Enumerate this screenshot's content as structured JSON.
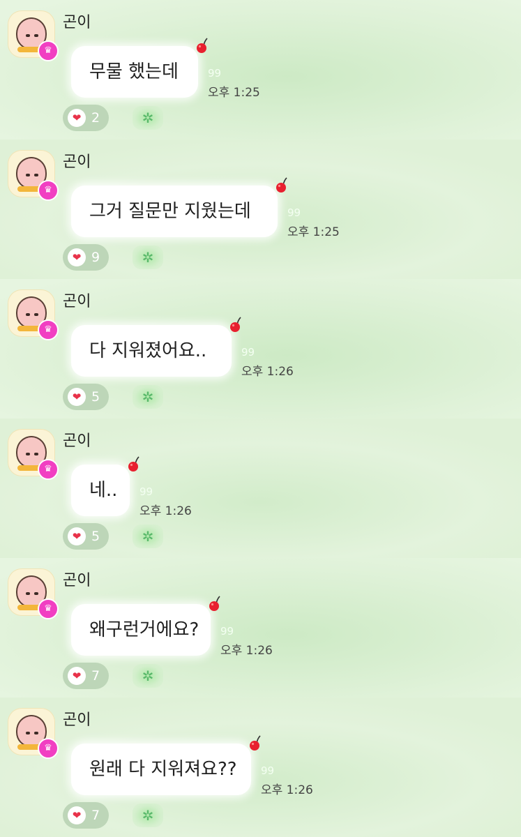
{
  "messages": [
    {
      "author": "곤이",
      "text": "무물 했는데",
      "read_count": "99",
      "time": "오후 1:25",
      "likes": "2"
    },
    {
      "author": "곤이",
      "text": "그거 질문만 지웠는데",
      "read_count": "99",
      "time": "오후 1:25",
      "likes": "9"
    },
    {
      "author": "곤이",
      "text": "다 지워졌어요..",
      "read_count": "99",
      "time": "오후 1:26",
      "likes": "5"
    },
    {
      "author": "곤이",
      "text": "네..",
      "read_count": "99",
      "time": "오후 1:26",
      "likes": "5"
    },
    {
      "author": "곤이",
      "text": "왜구런거에요?",
      "read_count": "99",
      "time": "오후 1:26",
      "likes": "7"
    },
    {
      "author": "곤이",
      "text": "원래 다 지워져요??",
      "read_count": "99",
      "time": "오후 1:26",
      "likes": "7"
    }
  ],
  "icons": {
    "avatar": "peach-character-avatar",
    "badge": "crown-icon",
    "bubble_marker": "cherry-icon",
    "like": "heart-icon",
    "reaction": "sparkle-icon"
  },
  "colors": {
    "background": "#dcefd5",
    "bubble": "#ffffff",
    "crown_badge": "#f13fc2",
    "heart": "#e8324a",
    "like_pill": "#bdd6b8"
  }
}
